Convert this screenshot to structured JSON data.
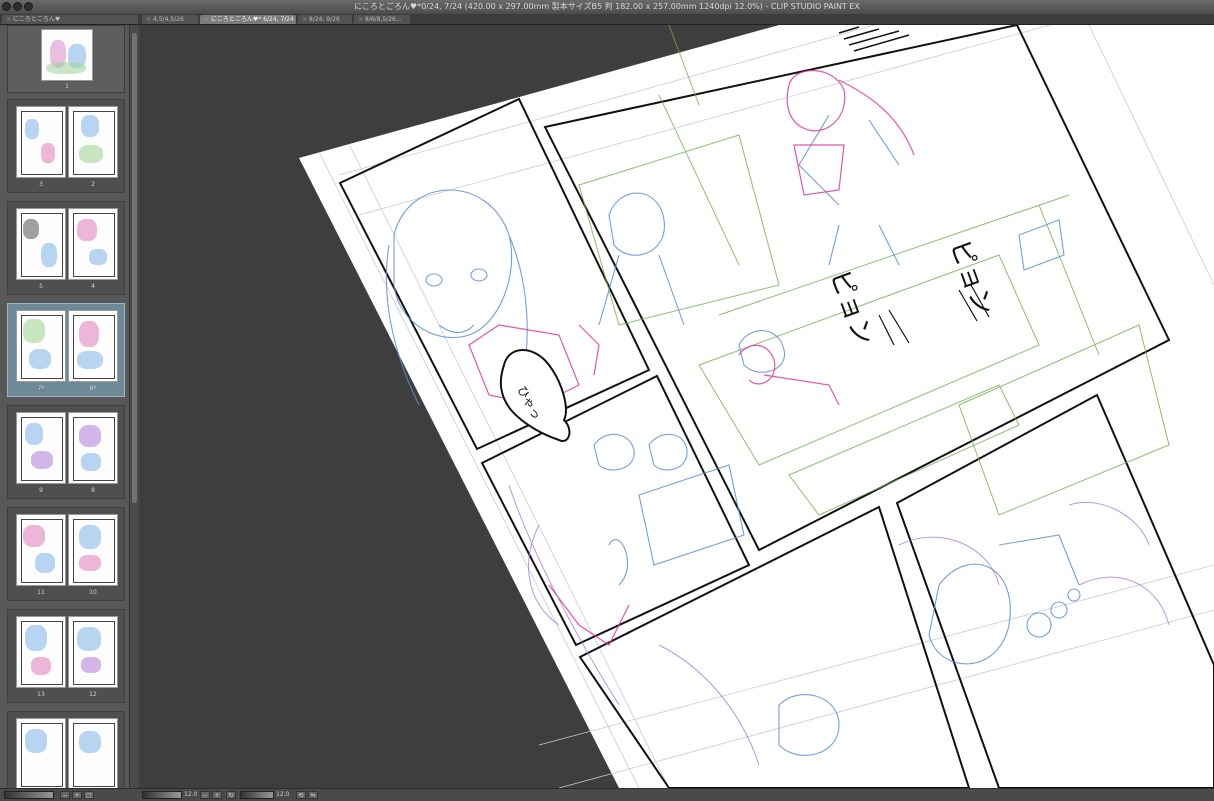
{
  "window": {
    "title": "にころとごろん♥*0/24, 7/24 (420.00 x 297.00mm 製本サイズB5 判 182.00 x 257.00mm 1240dpi 12.0%) - CLIP STUDIO PAINT EX"
  },
  "tabs": [
    {
      "label": "にころとごろん♥",
      "active": false
    },
    {
      "label": "4,5/4,5/26",
      "active": false
    },
    {
      "label": "にころとごろん♥* 6/24, 7/24",
      "active": true
    },
    {
      "label": "8/24, 9/26",
      "active": false
    },
    {
      "label": "8/6/8,5/26...",
      "active": false
    }
  ],
  "page_panel": {
    "title": "にころとごろん♥",
    "pages": [
      {
        "label": "1"
      },
      {
        "label_left": "3",
        "label_right": "2"
      },
      {
        "label_left": "5",
        "label_right": "4"
      },
      {
        "label_left": "7*",
        "label_right": "6*",
        "selected": true
      },
      {
        "label_left": "9",
        "label_right": "8"
      },
      {
        "label_left": "11",
        "label_right": "10"
      },
      {
        "label_left": "13",
        "label_right": "12"
      },
      {
        "label_left": "",
        "label_right": ""
      }
    ]
  },
  "canvas": {
    "sfx": [
      "ピョン",
      "ピョン"
    ],
    "bubble_text": "ひゃっ"
  },
  "status_bar": {
    "left_zoom": "12.0",
    "right_zoom": "12.0"
  },
  "colors": {
    "blue_line": "#5b8fd6",
    "pink_line": "#e0389a",
    "green_line": "#6fae4f",
    "purple_line": "#9a6ad6",
    "lavender_bg": "#c9c9f0"
  }
}
